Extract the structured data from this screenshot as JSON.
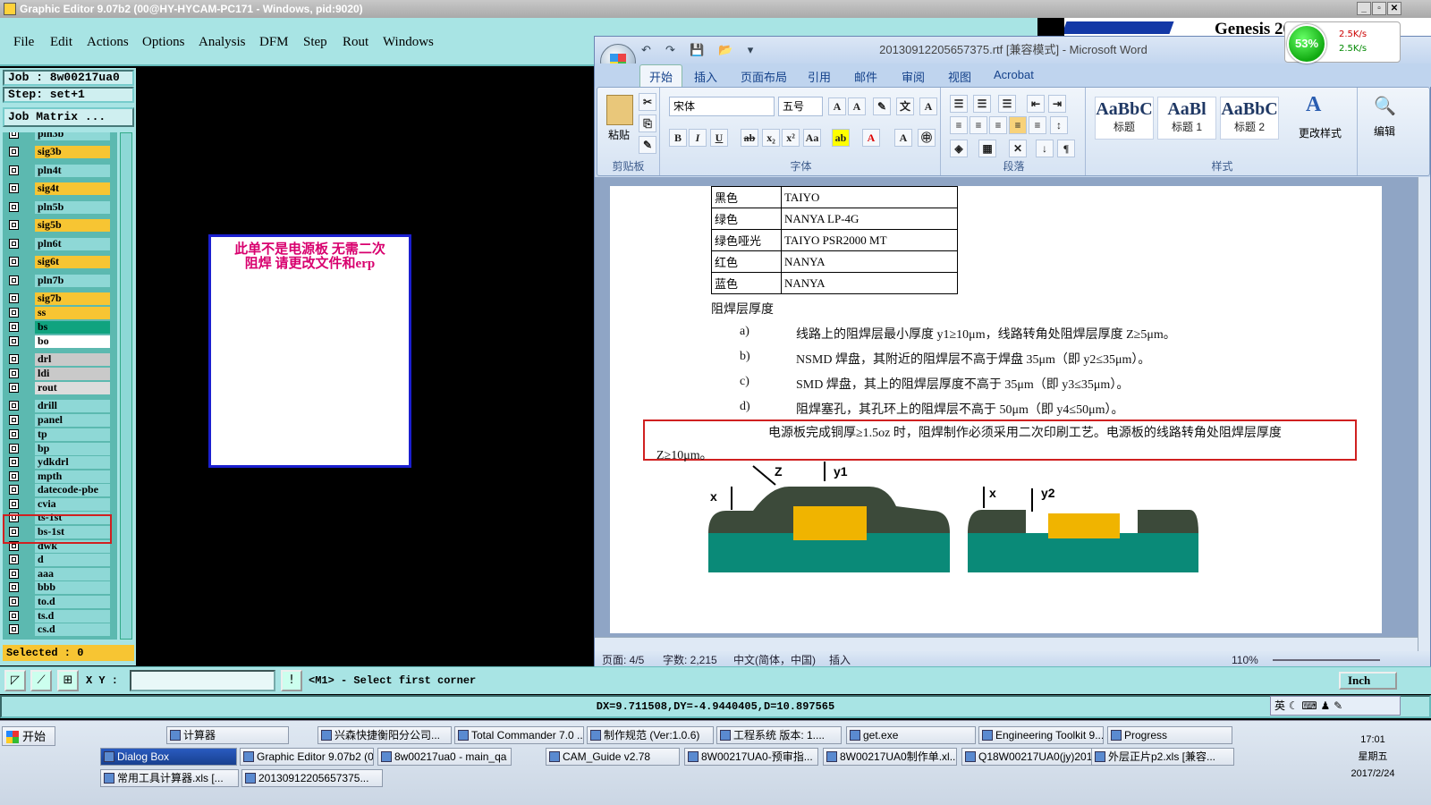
{
  "titlebar": {
    "title": "Graphic Editor 9.07b2 (00@HY-HYCAM-PC171 - Windows, pid:9020)"
  },
  "menu": [
    "File",
    "Edit",
    "Actions",
    "Options",
    "Analysis",
    "DFM",
    "Step",
    "Rout",
    "Windows"
  ],
  "genesis": {
    "text": "Genesis 20"
  },
  "speed": {
    "percent": "53%",
    "up": "2.5K/s",
    "down": "2.5K/s"
  },
  "panel": {
    "job": "Job : 8w00217ua0",
    "step": "Step: set+1",
    "matrix": "Job Matrix ...",
    "selected": "Selected : 0"
  },
  "layers": [
    {
      "name": "pln3b",
      "color": "#8ed8d6"
    },
    {
      "name": "sig3b",
      "color": "#f7c533"
    },
    {
      "name": "pln4t",
      "color": "#8ed8d6"
    },
    {
      "name": "sig4t",
      "color": "#f7c533"
    },
    {
      "name": "pln5b",
      "color": "#8ed8d6"
    },
    {
      "name": "sig5b",
      "color": "#f7c533"
    },
    {
      "name": "pln6t",
      "color": "#8ed8d6"
    },
    {
      "name": "sig6t",
      "color": "#f7c533"
    },
    {
      "name": "pln7b",
      "color": "#8ed8d6"
    },
    {
      "name": "sig7b",
      "color": "#f7c533"
    },
    {
      "name": "ss",
      "color": "#f7c533"
    },
    {
      "name": "bs",
      "color": "#10a37f"
    },
    {
      "name": "bo",
      "color": "#ffffff"
    },
    {
      "name": "drl",
      "color": "#c9c9c9"
    },
    {
      "name": "ldi",
      "color": "#c9c9c9"
    },
    {
      "name": "rout",
      "color": "#dcdcdc"
    },
    {
      "name": "drill",
      "color": "#8ed8d6"
    },
    {
      "name": "panel",
      "color": "#8ed8d6"
    },
    {
      "name": "tp",
      "color": "#8ed8d6"
    },
    {
      "name": "bp",
      "color": "#8ed8d6"
    },
    {
      "name": "ydkdrl",
      "color": "#8ed8d6"
    },
    {
      "name": "mpth",
      "color": "#8ed8d6"
    },
    {
      "name": "datecode-pbe",
      "color": "#8ed8d6"
    },
    {
      "name": "cvia",
      "color": "#8ed8d6"
    },
    {
      "name": "ts-1st",
      "color": "#8ed8d6"
    },
    {
      "name": "bs-1st",
      "color": "#8ed8d6"
    },
    {
      "name": "dwk",
      "color": "#8ed8d6"
    },
    {
      "name": "d",
      "color": "#8ed8d6"
    },
    {
      "name": "aaa",
      "color": "#8ed8d6"
    },
    {
      "name": "bbb",
      "color": "#8ed8d6"
    },
    {
      "name": "to.d",
      "color": "#8ed8d6"
    },
    {
      "name": "ts.d",
      "color": "#8ed8d6"
    },
    {
      "name": "cs.d",
      "color": "#8ed8d6"
    }
  ],
  "note": {
    "line1": "此单不是电源板   无需二次",
    "line2": "阻焊  请更改文件和erp"
  },
  "cmd": {
    "xy_label": "X Y :",
    "xy_value": "",
    "prompt": "<M1> - Select first corner",
    "unit": "Inch"
  },
  "status": {
    "coords": "DX=9.711508,DY=-4.9440405,D=10.897565"
  },
  "word": {
    "title": "20130912205657375.rtf [兼容模式] - Microsoft Word",
    "tabs": [
      "开始",
      "插入",
      "页面布局",
      "引用",
      "邮件",
      "审阅",
      "视图",
      "Acrobat"
    ],
    "font": "宋体",
    "size": "五号",
    "groups": {
      "clipboard": "剪贴板",
      "font": "字体",
      "paragraph": "段落",
      "styles": "样式",
      "paste": "粘贴",
      "change_styles": "更改样式",
      "edit": "编辑"
    },
    "styles": [
      {
        "sample": "AaBbC",
        "name": "标题"
      },
      {
        "sample": "AaBl",
        "name": "标题 1"
      },
      {
        "sample": "AaBbC",
        "name": "标题 2"
      }
    ],
    "table": [
      [
        "黑色",
        "TAIYO"
      ],
      [
        "绿色",
        "NANYA  LP-4G"
      ],
      [
        "绿色哑光",
        "TAIYO   PSR2000 MT"
      ],
      [
        "红色",
        "NANYA"
      ],
      [
        "蓝色",
        "NANYA"
      ]
    ],
    "heading": "阻焊层厚度",
    "items": [
      {
        "k": "a)",
        "t": "线路上的阻焊层最小厚度 y1≥10μm，线路转角处阻焊层厚度 Z≥5μm。"
      },
      {
        "k": "b)",
        "t": "NSMD 焊盘，其附近的阻焊层不高于焊盘 35μm（即 y2≤35μm）。"
      },
      {
        "k": "c)",
        "t": "SMD 焊盘，其上的阻焊层厚度不高于 35μm（即 y3≤35μm）。"
      },
      {
        "k": "d)",
        "t": "阻焊塞孔，其孔环上的阻焊层不高于 50μm（即 y4≤50μm）。"
      }
    ],
    "highlight1": "电源板完成铜厚≥1.5oz 时，阻焊制作必须采用二次印刷工艺。电源板的线路转角处阻焊层厚度",
    "highlight2": "Z≥10μm。",
    "diagram_labels": [
      "Z",
      "y1",
      "x",
      "x",
      "y2"
    ],
    "statusbar": {
      "page": "页面: 4/5",
      "words": "字数: 2,215",
      "lang": "中文(简体，中国)",
      "mode": "插入",
      "zoom": "110%"
    }
  },
  "taskbar": {
    "start": "开始",
    "row1": [
      "计算器",
      "兴森快捷衡阳分公司...",
      "Total Commander 7.0 ...",
      "制作规范 (Ver:1.0.6)",
      "工程系统  版本: 1....",
      "get.exe",
      "Engineering Toolkit 9....",
      "Progress"
    ],
    "row2": [
      "Dialog Box",
      "Graphic Editor 9.07b2 (0...",
      "8w00217ua0 - main_qa",
      "CAM_Guide v2.78",
      "8W00217UA0-预审指...",
      "8W00217UA0制作单.xl...",
      "Q18W00217UA0(jy)201...",
      "外层正片p2.xls [兼容..."
    ],
    "row3": [
      "常用工具计算器.xls [...",
      "20130912205657375..."
    ],
    "time": "17:01",
    "weekday": "星期五",
    "date": "2017/2/24",
    "ime": "英"
  }
}
